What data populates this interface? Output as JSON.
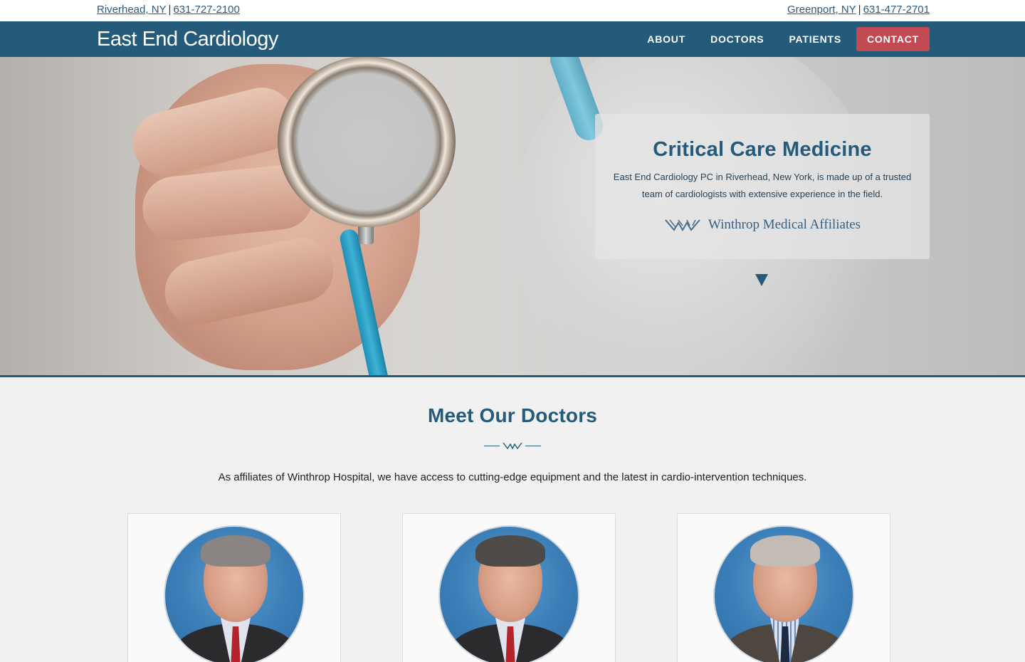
{
  "topbar": {
    "left_city": "Riverhead, NY",
    "left_phone": "631-727-2100",
    "right_city": "Greenport, NY",
    "right_phone": "631-477-2701",
    "separator": "|"
  },
  "nav": {
    "brand": "East End Cardiology",
    "items": [
      "ABOUT",
      "DOCTORS",
      "PATIENTS"
    ],
    "cta": "CONTACT"
  },
  "hero": {
    "title": "Critical Care Medicine",
    "text": "East End Cardiology PC in Riverhead, New York, is made up of a trusted team of cardiologists with extensive experience in the field.",
    "affiliate": "Winthrop Medical Affiliates"
  },
  "doctors_section": {
    "title": "Meet Our Doctors",
    "text": "As affiliates of Winthrop Hospital, we have access to cutting-edge equipment and the latest in cardio-intervention techniques."
  },
  "colors": {
    "brand": "#245a7a",
    "cta": "#c24a52",
    "background": "#f1f1f1"
  }
}
